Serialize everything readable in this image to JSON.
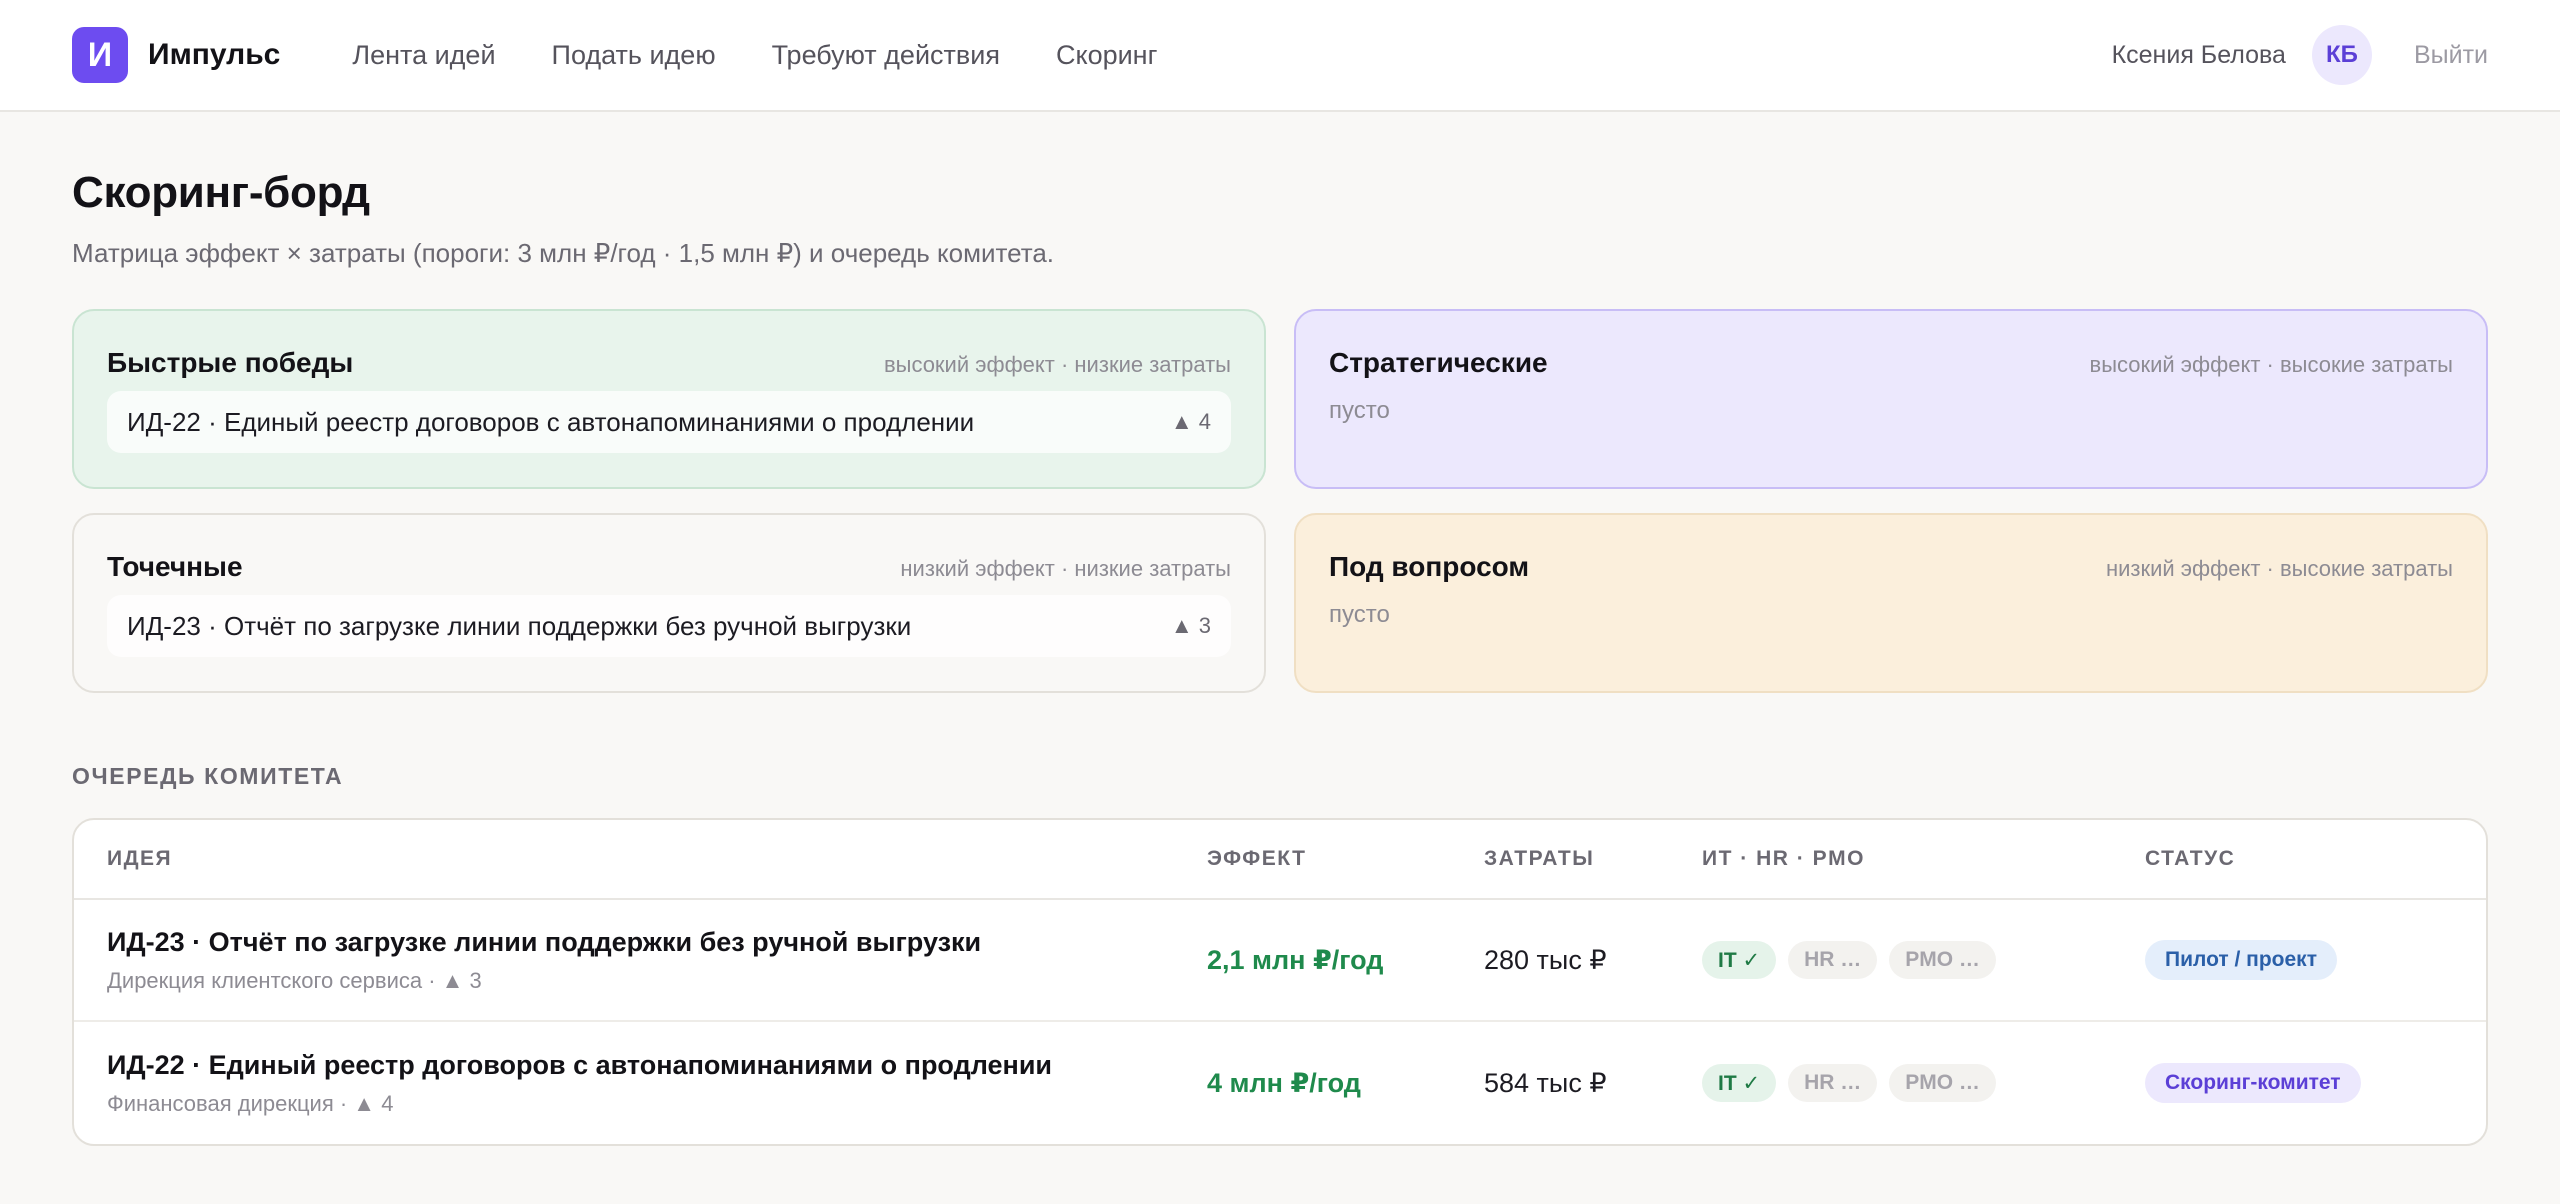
{
  "header": {
    "logo_letter": "И",
    "brand": "Импульс",
    "nav": [
      {
        "label": "Лента идей"
      },
      {
        "label": "Подать идею"
      },
      {
        "label": "Требуют действия"
      },
      {
        "label": "Скоринг",
        "active": true
      }
    ],
    "user_name": "Ксения Белова",
    "avatar_initials": "КБ",
    "logout_label": "Выйти"
  },
  "page": {
    "title": "Скоринг-борд",
    "subtitle": "Матрица эффект × затраты (пороги: 3 млн ₽/год · 1,5 млн ₽) и очередь комитета."
  },
  "matrix": {
    "quick": {
      "title": "Быстрые победы",
      "hint": "высокий эффект · низкие затраты",
      "item": "ИД-22 · Единый реестр договоров с автонапоминаниями о продлении",
      "votes": "▲ 4"
    },
    "strategic": {
      "title": "Стратегические",
      "hint": "высокий эффект · высокие затраты",
      "empty": "пусто"
    },
    "point": {
      "title": "Точечные",
      "hint": "низкий эффект · низкие затраты",
      "item": "ИД-23 · Отчёт по загрузке линии поддержки без ручной выгрузки",
      "votes": "▲ 3"
    },
    "question": {
      "title": "Под вопросом",
      "hint": "низкий эффект · высокие затраты",
      "empty": "пусто"
    }
  },
  "queue": {
    "section_label": "ОЧЕРЕДЬ КОМИТЕТА",
    "columns": {
      "idea": "ИДЕЯ",
      "effect": "ЭФФЕКТ",
      "cost": "ЗАТРАТЫ",
      "review": "ИТ · HR · PMO",
      "status": "СТАТУС"
    },
    "rows": [
      {
        "title": "ИД-23 · Отчёт по загрузке линии поддержки без ручной выгрузки",
        "meta": "Дирекция клиентского сервиса · ▲ 3",
        "effect": "2,1 млн ₽/год",
        "cost": "280 тыс ₽",
        "it": "IT ✓",
        "hr": "HR …",
        "pmo": "PMO …",
        "status": "Пилот / проект"
      },
      {
        "title": "ИД-22 · Единый реестр договоров с автонапоминаниями о продлении",
        "meta": "Финансовая дирекция · ▲ 4",
        "effect": "4 млн ₽/год",
        "cost": "584 тыс ₽",
        "it": "IT ✓",
        "hr": "HR …",
        "pmo": "PMO …",
        "status": "Скоринг-комитет"
      }
    ]
  },
  "colors": {
    "brand": "#6d4cf0",
    "effect_green": "#1f8a4c",
    "quick_bg": "#e8f4ec",
    "strategic_bg": "#ece8fd",
    "question_bg": "#fbefdc"
  }
}
